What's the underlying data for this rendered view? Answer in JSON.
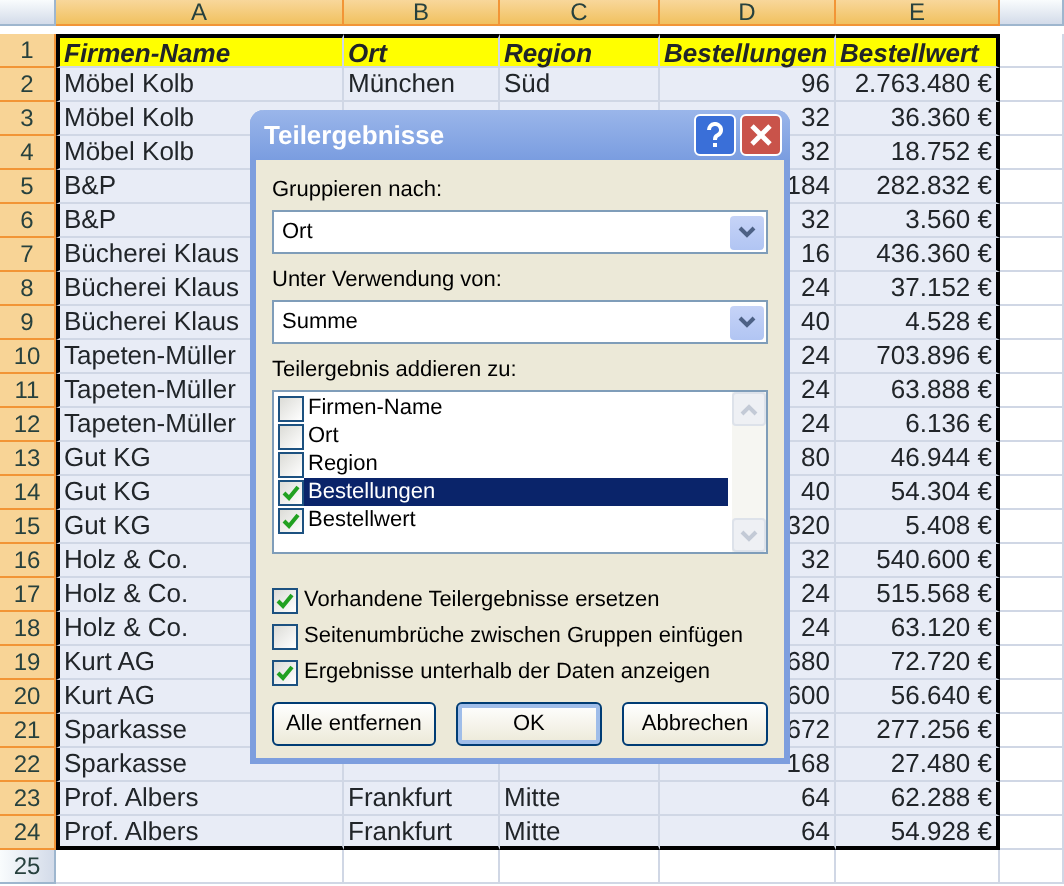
{
  "sheet": {
    "columns": [
      {
        "label": "A",
        "selected": true
      },
      {
        "label": "B",
        "selected": true
      },
      {
        "label": "C",
        "selected": true
      },
      {
        "label": "D",
        "selected": true
      },
      {
        "label": "E",
        "selected": true
      }
    ],
    "rows": [
      {
        "number": "1",
        "kind": "header",
        "selected": true,
        "cells": {
          "A": "Firmen-Name",
          "B": "Ort",
          "C": "Region",
          "D": "Bestellungen",
          "E": "Bestellwert"
        }
      },
      {
        "number": "2",
        "kind": "data",
        "selected": true,
        "cells": {
          "A": "Möbel Kolb",
          "B": "München",
          "C": "Süd",
          "D": "96",
          "E": "2.763.480 €"
        }
      },
      {
        "number": "3",
        "kind": "data",
        "selected": true,
        "cells": {
          "A": "Möbel Kolb",
          "D": "32",
          "E": "36.360 €"
        }
      },
      {
        "number": "4",
        "kind": "data",
        "selected": true,
        "cells": {
          "A": "Möbel Kolb",
          "D": "32",
          "E": "18.752 €"
        }
      },
      {
        "number": "5",
        "kind": "data",
        "selected": true,
        "cells": {
          "A": "B&P",
          "D": "184",
          "E": "282.832 €"
        }
      },
      {
        "number": "6",
        "kind": "data",
        "selected": true,
        "cells": {
          "A": "B&P",
          "D": "32",
          "E": "3.560 €"
        }
      },
      {
        "number": "7",
        "kind": "data",
        "selected": true,
        "cells": {
          "A": "Bücherei Klaus",
          "D": "16",
          "E": "436.360 €"
        }
      },
      {
        "number": "8",
        "kind": "data",
        "selected": true,
        "cells": {
          "A": "Bücherei Klaus",
          "D": "24",
          "E": "37.152 €"
        }
      },
      {
        "number": "9",
        "kind": "data",
        "selected": true,
        "cells": {
          "A": "Bücherei Klaus",
          "D": "40",
          "E": "4.528 €"
        }
      },
      {
        "number": "10",
        "kind": "data",
        "selected": true,
        "cells": {
          "A": "Tapeten-Müller",
          "D": "24",
          "E": "703.896 €"
        }
      },
      {
        "number": "11",
        "kind": "data",
        "selected": true,
        "cells": {
          "A": "Tapeten-Müller",
          "D": "24",
          "E": "63.888 €"
        }
      },
      {
        "number": "12",
        "kind": "data",
        "selected": true,
        "cells": {
          "A": "Tapeten-Müller",
          "D": "24",
          "E": "6.136 €"
        }
      },
      {
        "number": "13",
        "kind": "data",
        "selected": true,
        "cells": {
          "A": "Gut KG",
          "D": "80",
          "E": "46.944 €"
        }
      },
      {
        "number": "14",
        "kind": "data",
        "selected": true,
        "cells": {
          "A": "Gut KG",
          "D": "40",
          "E": "54.304 €"
        }
      },
      {
        "number": "15",
        "kind": "data",
        "selected": true,
        "cells": {
          "A": "Gut KG",
          "D": "320",
          "E": "5.408 €"
        }
      },
      {
        "number": "16",
        "kind": "data",
        "selected": true,
        "cells": {
          "A": "Holz & Co.",
          "D": "32",
          "E": "540.600 €"
        }
      },
      {
        "number": "17",
        "kind": "data",
        "selected": true,
        "cells": {
          "A": "Holz & Co.",
          "D": "24",
          "E": "515.568 €"
        }
      },
      {
        "number": "18",
        "kind": "data",
        "selected": true,
        "cells": {
          "A": "Holz & Co.",
          "D": "24",
          "E": "63.120 €"
        }
      },
      {
        "number": "19",
        "kind": "data",
        "selected": true,
        "cells": {
          "A": "Kurt AG",
          "D": "680",
          "E": "72.720 €"
        }
      },
      {
        "number": "20",
        "kind": "data",
        "selected": true,
        "cells": {
          "A": "Kurt AG",
          "D": "600",
          "E": "56.640 €"
        }
      },
      {
        "number": "21",
        "kind": "data",
        "selected": true,
        "cells": {
          "A": "Sparkasse",
          "D": "672",
          "E": "277.256 €"
        }
      },
      {
        "number": "22",
        "kind": "data",
        "selected": true,
        "cells": {
          "A": "Sparkasse",
          "D": "168",
          "E": "27.480 €"
        }
      },
      {
        "number": "23",
        "kind": "data",
        "selected": true,
        "cells": {
          "A": "Prof. Albers",
          "B": "Frankfurt",
          "C": "Mitte",
          "D": "64",
          "E": "62.288 €"
        }
      },
      {
        "number": "24",
        "kind": "data",
        "selected": true,
        "cells": {
          "A": "Prof. Albers",
          "B": "Frankfurt",
          "C": "Mitte",
          "D": "64",
          "E": "54.928 €"
        }
      },
      {
        "number": "25",
        "kind": "data",
        "selected": false,
        "cells": {}
      }
    ]
  },
  "dialog": {
    "title": "Teilergebnisse",
    "group_by": {
      "label": "Gruppieren nach:",
      "value": "Ort"
    },
    "function": {
      "label": "Unter Verwendung von:",
      "value": "Summe"
    },
    "add_to": {
      "label": "Teilergebnis addieren zu:",
      "items": [
        {
          "label": "Firmen-Name",
          "checked": false,
          "selected": false
        },
        {
          "label": "Ort",
          "checked": false,
          "selected": false
        },
        {
          "label": "Region",
          "checked": false,
          "selected": false
        },
        {
          "label": "Bestellungen",
          "checked": true,
          "selected": true
        },
        {
          "label": "Bestellwert",
          "checked": true,
          "selected": false
        }
      ]
    },
    "options": [
      {
        "label": "Vorhandene Teilergebnisse ersetzen",
        "checked": true
      },
      {
        "label": "Seitenumbrüche zwischen Gruppen einfügen",
        "checked": false
      },
      {
        "label": "Ergebnisse unterhalb der Daten anzeigen",
        "checked": true
      }
    ],
    "buttons": [
      {
        "label": "Alle entfernen",
        "default": false
      },
      {
        "label": "OK",
        "default": true
      },
      {
        "label": "Abbrechen",
        "default": false
      }
    ]
  }
}
